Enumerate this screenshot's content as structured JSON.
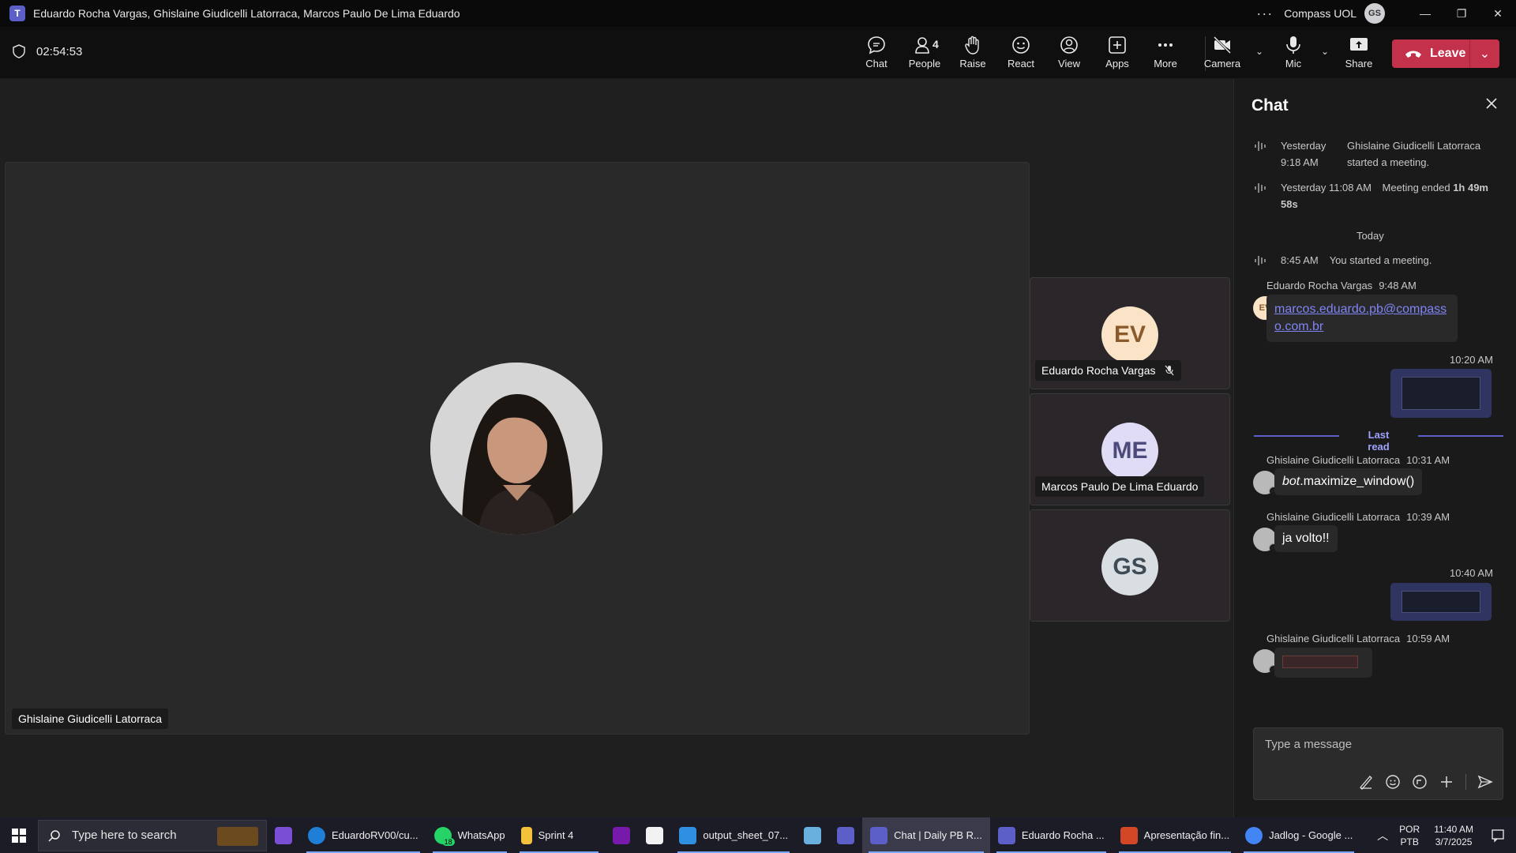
{
  "window": {
    "title": "Eduardo Rocha Vargas, Ghislaine Giudicelli Latorraca, Marcos Paulo De Lima Eduardo",
    "more": "···",
    "org": "Compass UOL",
    "user_initials": "GS",
    "minimize": "—",
    "restore": "❐",
    "close": "✕"
  },
  "toolbar": {
    "timer": "02:54:53",
    "chat": "Chat",
    "people": "People",
    "people_count": "4",
    "raise": "Raise",
    "react": "React",
    "view": "View",
    "apps": "Apps",
    "more": "More",
    "camera": "Camera",
    "mic": "Mic",
    "share": "Share",
    "leave": "Leave"
  },
  "stage": {
    "main_participant": "Ghislaine Giudicelli Latorraca",
    "tiles": [
      {
        "initials": "EV",
        "name": "Eduardo Rocha Vargas",
        "muted": true,
        "avatar_bg": "#fbe3c8",
        "avatar_fg": "#8a5a2b"
      },
      {
        "initials": "ME",
        "name": "Marcos Paulo De Lima Eduardo",
        "muted": false,
        "avatar_bg": "#e0dcf5",
        "avatar_fg": "#4b4a7a"
      },
      {
        "initials": "GS",
        "name": "",
        "muted": false,
        "avatar_bg": "#d8dee2",
        "avatar_fg": "#3e4b55"
      }
    ]
  },
  "chat": {
    "title": "Chat",
    "system": [
      {
        "time": "Yesterday 9:18 AM",
        "text": "Ghislaine Giudicelli Latorraca started a meeting."
      },
      {
        "time": "Yesterday 11:08 AM",
        "text_prefix": "Meeting ended",
        "duration": "1h 49m 58s"
      },
      {
        "time": "8:45 AM",
        "text": "You started a meeting."
      }
    ],
    "today": "Today",
    "messages": [
      {
        "sender": "Eduardo Rocha Vargas",
        "time": "9:48 AM",
        "initials": "EV",
        "text": "marcos.eduardo.pb@compasso.com.br"
      },
      {
        "mine": true,
        "time": "10:20 AM"
      },
      {
        "sender": "Ghislaine Giudicelli Latorraca",
        "time": "10:31 AM",
        "text_italic": "bot",
        "text": ".maximize_window()"
      },
      {
        "sender": "Ghislaine Giudicelli Latorraca",
        "time": "10:39 AM",
        "text": "ja volto!!"
      },
      {
        "mine": true,
        "time": "10:40 AM"
      },
      {
        "sender": "Ghislaine Giudicelli Latorraca",
        "time": "10:59 AM"
      }
    ],
    "last_read": "Last read",
    "composer_placeholder": "Type a message"
  },
  "taskbar": {
    "search_placeholder": "Type here to search",
    "items": [
      {
        "label": "EduardoRV00/cu...",
        "color": "#1f7fd6"
      },
      {
        "label": "WhatsApp",
        "color": "#25d366",
        "badge": "18"
      },
      {
        "label": "Sprint 4",
        "color": "#f3c13a"
      },
      {
        "label": "output_sheet_07...",
        "color": "#2f8fe0"
      },
      {
        "label": "Chat | Daily PB R...",
        "color": "#5b5fc7"
      },
      {
        "label": "Eduardo Rocha ...",
        "color": "#5b5fc7"
      },
      {
        "label": "Apresentação fin...",
        "color": "#d24726"
      },
      {
        "label": "Jadlog - Google ...",
        "color": "#4285f4"
      }
    ],
    "lang": "POR",
    "layout": "PTB",
    "time": "11:40 AM",
    "date": "3/7/2025"
  },
  "colors": {
    "accent": "#7f85f5",
    "leave": "#c4314b",
    "background": "#1f1f1f"
  }
}
